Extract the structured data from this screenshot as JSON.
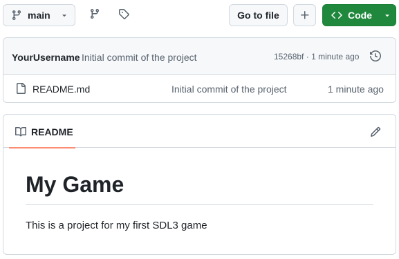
{
  "toolbar": {
    "branch_name": "main",
    "goto_file_label": "Go to file",
    "code_button_label": "Code"
  },
  "latest_commit": {
    "author": "YourUsername",
    "message": "Initial commit of the project",
    "hash": "15268bf",
    "separator": "·",
    "time": "1 minute ago"
  },
  "files": [
    {
      "name": "README.md",
      "commit_message": "Initial commit of the project",
      "time": "1 minute ago"
    }
  ],
  "readme": {
    "tab_label": "README",
    "heading": "My Game",
    "paragraph": "This is a project for my first SDL3 game"
  },
  "colors": {
    "accent_green": "#1f883d",
    "tab_underline": "#fd8c73",
    "border": "#d1d9e0",
    "muted_text": "#59636e"
  },
  "icons": [
    "git-branch-icon",
    "caret-down-icon",
    "branches-icon",
    "tag-icon",
    "plus-icon",
    "code-icon",
    "history-icon",
    "file-icon",
    "book-icon",
    "pencil-icon"
  ]
}
